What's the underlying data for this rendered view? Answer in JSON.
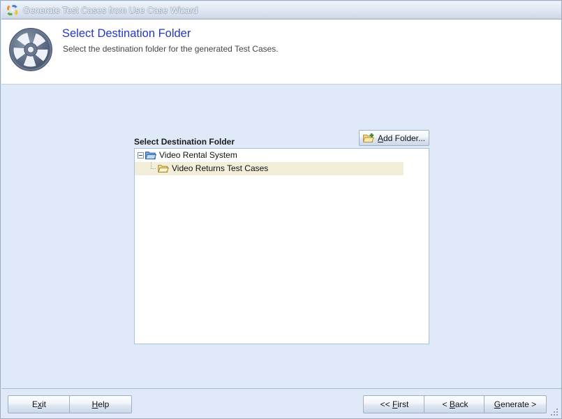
{
  "window": {
    "title": "Generate Test Cases from Use Case Wizard",
    "title_icon": "recycle-arrows-icon"
  },
  "header": {
    "icon": "gear-wheel-icon",
    "title": "Select Destination Folder",
    "subtitle": "Select the destination folder for the generated Test Cases."
  },
  "main": {
    "section_label": "Select Destination Folder",
    "add_folder": {
      "label": "Add Folder...",
      "accel": "A",
      "icon": "folder-add-icon"
    },
    "tree": {
      "nodes": [
        {
          "label": "Video Rental System",
          "icon": "folder-open-blue-icon",
          "expanded": true,
          "selected": false,
          "level": 0
        },
        {
          "label": "Video Returns Test Cases",
          "icon": "folder-open-yellow-icon",
          "expanded": false,
          "selected": true,
          "level": 1
        }
      ]
    }
  },
  "footer": {
    "buttons": [
      {
        "id": "exit",
        "label": "Exit",
        "accel": "x"
      },
      {
        "id": "help",
        "label": "Help",
        "accel": "H"
      },
      {
        "id": "first",
        "label": "<< First",
        "accel": "F"
      },
      {
        "id": "back",
        "label": "< Back",
        "accel": "B"
      },
      {
        "id": "generate",
        "label": "Generate >",
        "accel": "G"
      }
    ],
    "resize_grip": "resize-grip-icon"
  },
  "colors": {
    "window_background": "#dfe9f8",
    "header_background": "#ffffff",
    "title_color": "#2636c8",
    "selection_background": "#f3eeda",
    "panel_border": "#a9c2dc"
  }
}
